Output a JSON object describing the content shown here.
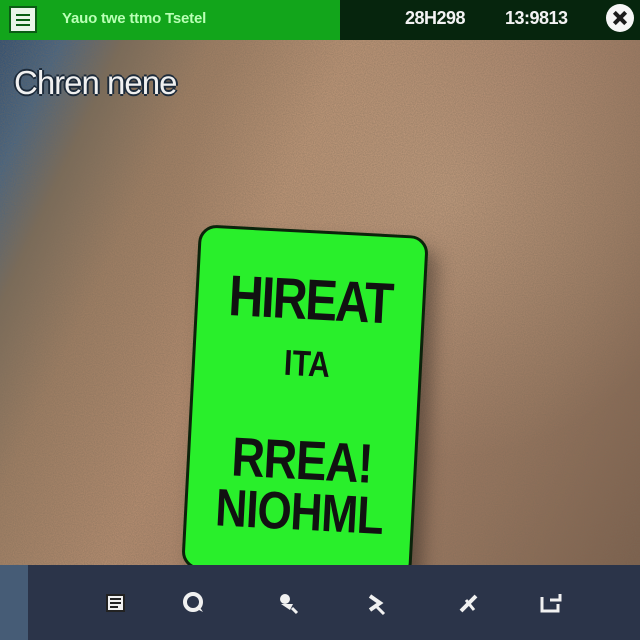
{
  "window": {
    "title": "Yauo twe ttmo Tsetel",
    "readouts": [
      "28H298",
      "13:9813"
    ],
    "icons": {
      "app": "document-icon",
      "close": "close-icon"
    }
  },
  "viewer": {
    "heading": "Chren nene",
    "sign": {
      "lines": [
        "HIREAT",
        "ITA",
        "RREA!",
        "NIOHML"
      ],
      "color": "#29ef2b"
    }
  },
  "toolbar": {
    "tools": [
      {
        "icon": "document-icon"
      },
      {
        "icon": "refresh-icon"
      },
      {
        "icon": "pin-icon"
      },
      {
        "icon": "share-icon"
      },
      {
        "icon": "tools-icon"
      },
      {
        "icon": "export-icon"
      }
    ]
  },
  "colors": {
    "topbar_green": "#12a51b",
    "topbar_dark": "#06250d",
    "toolbar_bg": "#2b3449"
  }
}
